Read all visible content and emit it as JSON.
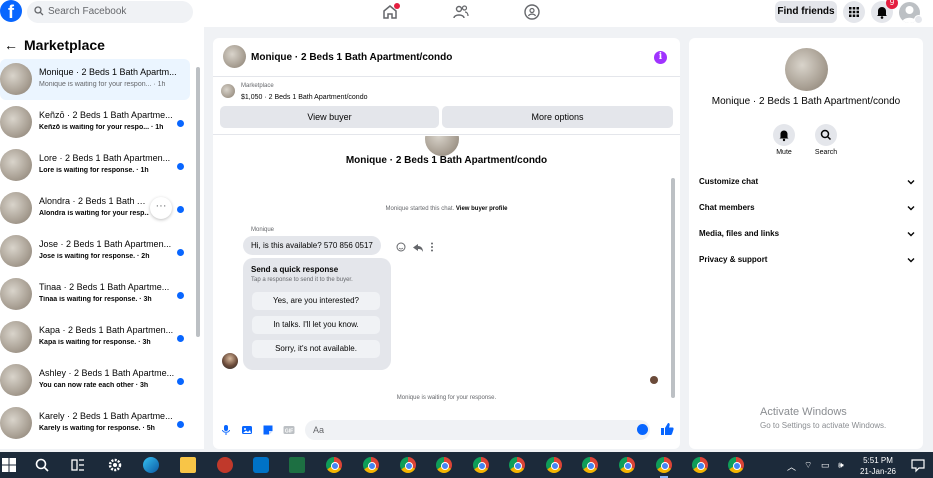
{
  "topbar": {
    "logo": "f",
    "search_placeholder": "Search Facebook",
    "find_friends": "Find friends",
    "notification_count": "9"
  },
  "sidebar": {
    "title": "Marketplace",
    "conversations": [
      {
        "name": "Monique · 2 Beds 1 Bath Apartm...",
        "sub": "Monique is waiting for your respon... · 1h",
        "unread": false
      },
      {
        "name": "Keñzō · 2 Beds 1 Bath Apartme...",
        "sub": "Keñzō is waiting for your respo... · 1h",
        "unread": true
      },
      {
        "name": "Lore · 2 Beds 1 Bath Apartmen...",
        "sub": "Lore is waiting for response. · 1h",
        "unread": true
      },
      {
        "name": "Alondra · 2 Beds 1 Bath Apart...",
        "sub": "Alondra is waiting for your resp...",
        "unread": true
      },
      {
        "name": "Jose · 2 Beds 1 Bath Apartmen...",
        "sub": "Jose is waiting for response. · 2h",
        "unread": true
      },
      {
        "name": "Tinaa · 2 Beds 1 Bath Apartme...",
        "sub": "Tinaa is waiting for response. · 3h",
        "unread": true
      },
      {
        "name": "Kapa · 2 Beds 1 Bath Apartmen...",
        "sub": "Kapa is waiting for response. · 3h",
        "unread": true
      },
      {
        "name": "Ashley · 2 Beds 1 Bath Apartme...",
        "sub": "You can now rate each other · 3h",
        "unread": true
      },
      {
        "name": "Karely · 2 Beds 1 Bath Apartme...",
        "sub": "Karely is waiting for response. · 5h",
        "unread": true
      }
    ],
    "more_glyph": "···"
  },
  "chat": {
    "header_title": "Monique · 2 Beds 1 Bath Apartment/condo",
    "info_glyph": "i",
    "listing_category": "Marketplace",
    "listing_price": "$1,050 · 2 Beds 1 Bath Apartment/condo",
    "view_buyer": "View buyer",
    "more_options": "More options",
    "center_title": "Monique · 2 Beds 1 Bath Apartment/condo",
    "system_msg": "Monique started this chat.",
    "system_link": "View buyer profile",
    "sender": "Monique",
    "message": "Hi, is this available? 570 856 0517",
    "quick_title": "Send a quick response",
    "quick_sub": "Tap a response to send it to the buyer.",
    "quick_options": [
      "Yes, are you interested?",
      "In talks. I'll let you know.",
      "Sorry, it's not available."
    ],
    "waiting": "Monique is waiting for your response.",
    "composer_placeholder": "Aa"
  },
  "details": {
    "title": "Monique · 2 Beds 1 Bath Apartment/condo",
    "mute": "Mute",
    "search": "Search",
    "rows": [
      "Customize chat",
      "Chat members",
      "Media, files and links",
      "Privacy & support"
    ]
  },
  "watermark": {
    "title": "Activate Windows",
    "sub": "Go to Settings to activate Windows."
  },
  "taskbar": {
    "time": "5:51 PM",
    "date": "21-Jan-26"
  },
  "colors": {
    "brand": "#0866ff",
    "badge": "#e41e3f",
    "info": "#a033ff"
  }
}
